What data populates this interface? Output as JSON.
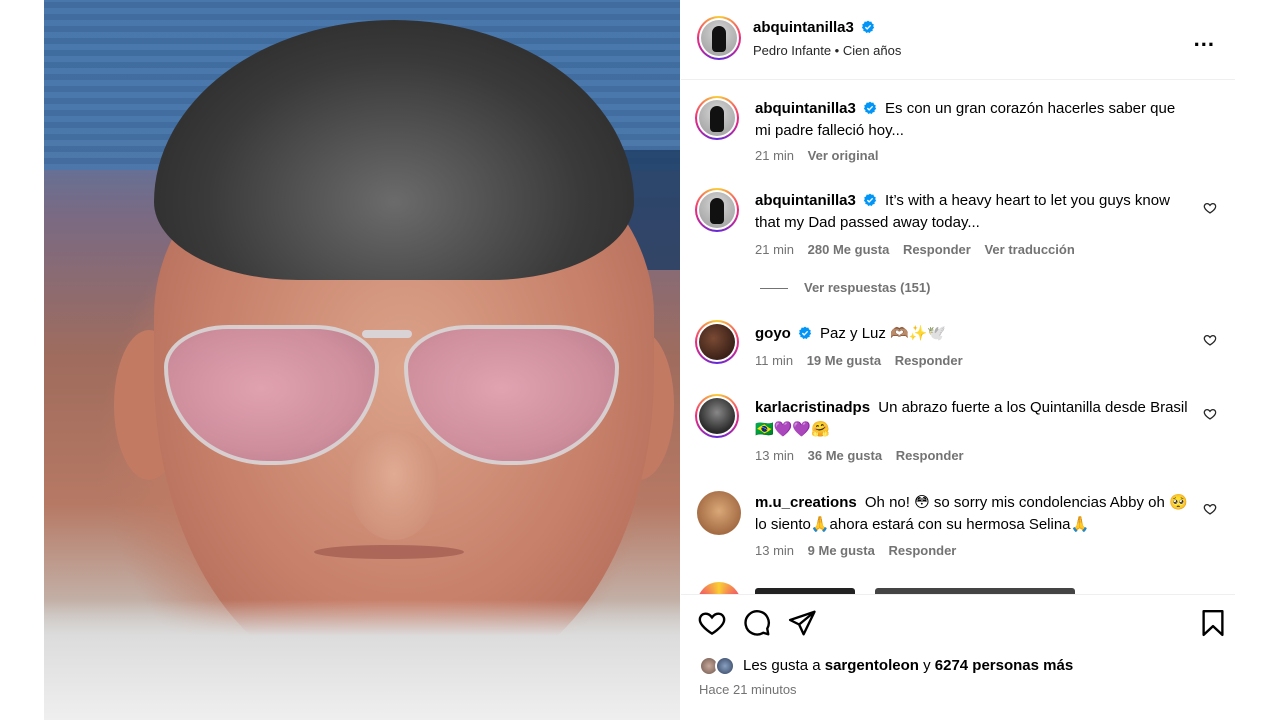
{
  "post": {
    "username": "abquintanilla3",
    "music": "Pedro Infante • Cien años",
    "more_label": "..."
  },
  "comments": [
    {
      "username": "abquintanilla3",
      "text": "Es con un gran corazón hacerles saber que mi padre falleció hoy...",
      "time": "21 min",
      "action": "Ver original"
    },
    {
      "username": "abquintanilla3",
      "text": "It’s with a heavy heart to let you guys know that my Dad passed away today...",
      "time": "21 min",
      "likes": "280 Me gusta",
      "reply": "Responder",
      "translate": "Ver traducción"
    },
    {
      "username": "goyo",
      "text": "Paz y Luz 🫶🏽✨🕊️",
      "time": "11 min",
      "likes": "19 Me gusta",
      "reply": "Responder"
    },
    {
      "username": "karlacristinadps",
      "text": "Un abrazo fuerte a los Quintanilla desde Brasil 🇧🇷💜💜🤗",
      "time": "13 min",
      "likes": "36 Me gusta",
      "reply": "Responder"
    },
    {
      "username": "m.u_creations",
      "text": "Oh no! 😳 so sorry mis condolencias Abby oh 🥺 lo siento🙏ahora estará con su hermosa Selina🙏",
      "time": "13 min",
      "likes": "9 Me gusta",
      "reply": "Responder"
    }
  ],
  "view_replies": "Ver respuestas (151)",
  "likes": {
    "prefix": "Les gusta a",
    "user": "sargentoleon",
    "middle": "y",
    "others": "6274 personas más"
  },
  "time_ago": "Hace 21 minutos",
  "icons": {
    "verified": "verified-badge-icon",
    "like": "heart-icon",
    "comment": "comment-bubble-icon",
    "share": "paper-plane-icon",
    "save": "bookmark-icon",
    "more": "more-options-icon"
  },
  "colors": {
    "verified": "#0095f6",
    "muted": "#737373",
    "divider": "#efefef"
  }
}
